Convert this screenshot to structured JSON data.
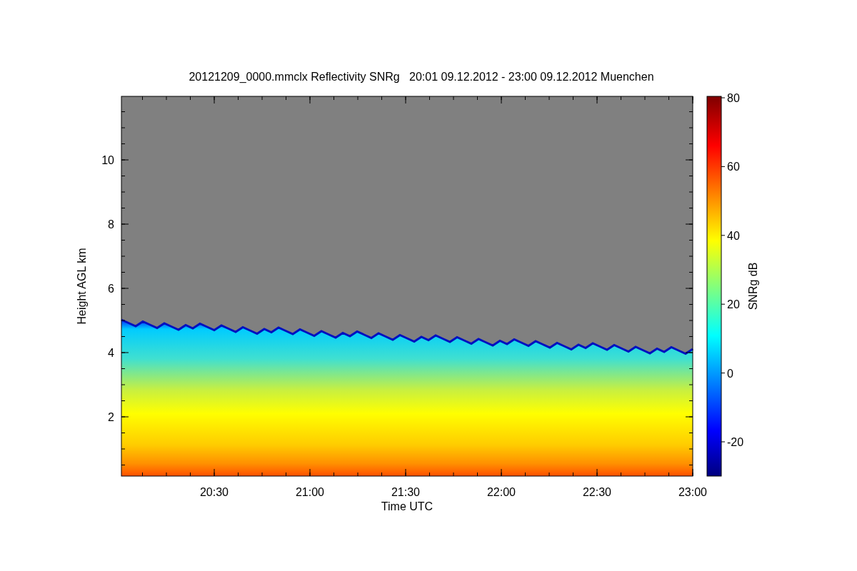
{
  "title": "20121209_0000.mmclx Reflectivity SNRg   20:01 09.12.2012 - 23:00 09.12.2012 Muenchen",
  "y_axis": {
    "label": "Height AGL km",
    "ticks": [
      "10",
      "8",
      "6",
      "4",
      "2"
    ]
  },
  "x_axis": {
    "label": "Time UTC",
    "ticks": [
      "20:30",
      "21:00",
      "21:30",
      "22:00",
      "22:30",
      "23:00"
    ]
  },
  "colorbar": {
    "label": "SNRg dB",
    "ticks": [
      "80",
      "60",
      "40",
      "20",
      "0",
      "-20"
    ]
  }
}
